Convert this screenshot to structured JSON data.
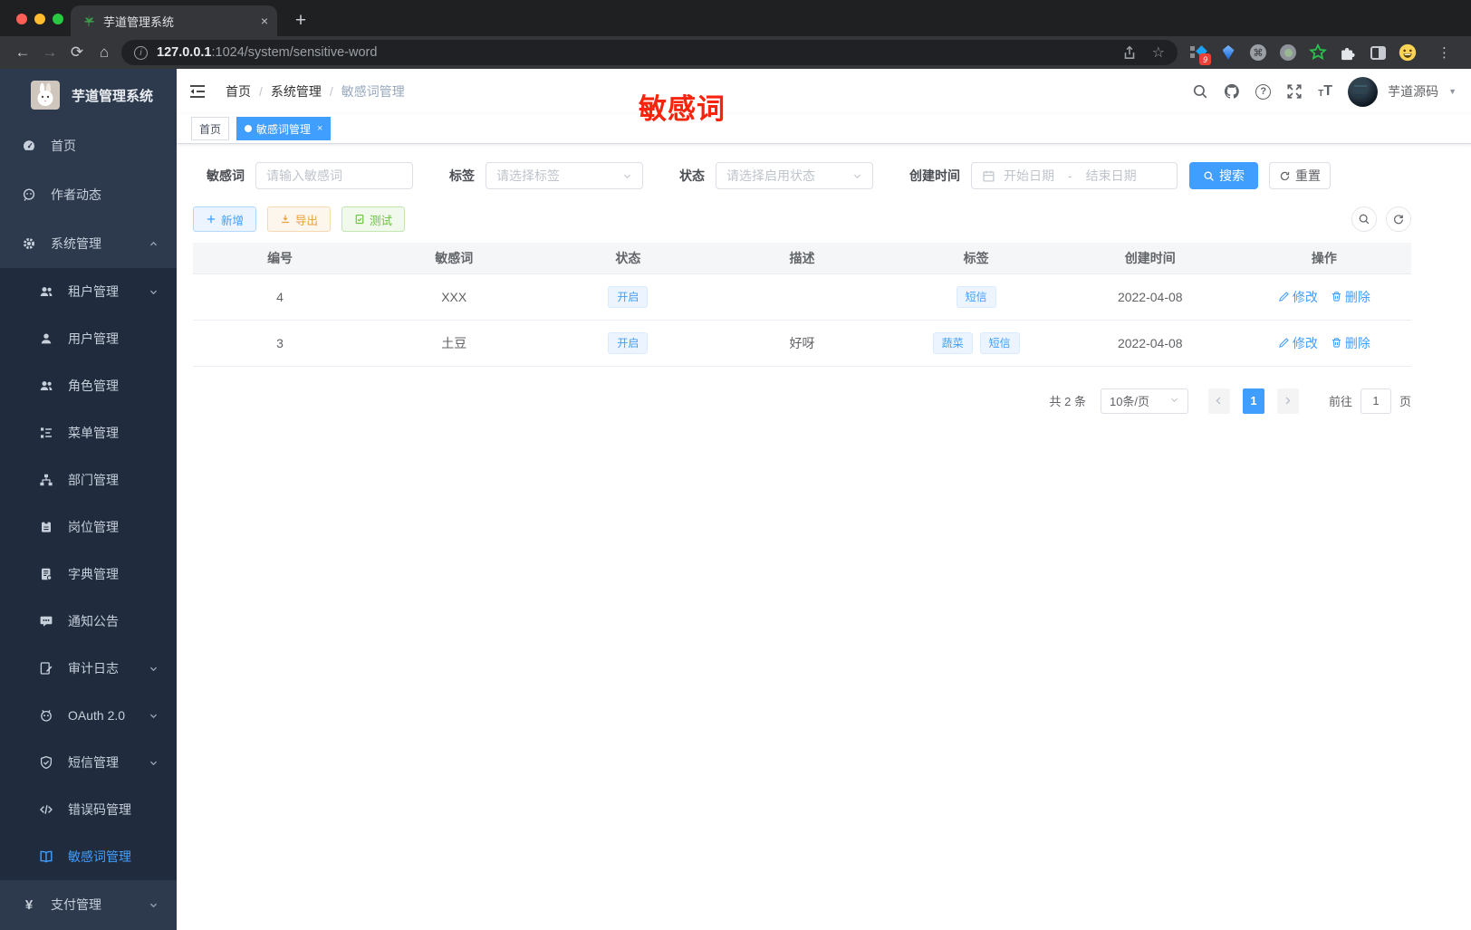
{
  "browser": {
    "tab_title": "芋道管理系统",
    "tab_close": "×",
    "new_tab_button": "+",
    "url_host": "127.0.0.1",
    "url_rest": ":1024/system/sensitive-word",
    "extension_badge": "9",
    "menu_dots": "⋮"
  },
  "sidebar": {
    "app_title": "芋道管理系统",
    "items": [
      {
        "label": "首页",
        "icon": "dashboard-icon",
        "level": 1
      },
      {
        "label": "作者动态",
        "icon": "author-feed-icon",
        "level": 1
      },
      {
        "label": "系统管理",
        "icon": "gear-icon",
        "level": 1,
        "arrow": "up"
      },
      {
        "label": "租户管理",
        "icon": "tenant-icon",
        "level": 2,
        "arrow": "down"
      },
      {
        "label": "用户管理",
        "icon": "user-icon",
        "level": 2
      },
      {
        "label": "角色管理",
        "icon": "role-icon",
        "level": 2
      },
      {
        "label": "菜单管理",
        "icon": "menu-tree-icon",
        "level": 2
      },
      {
        "label": "部门管理",
        "icon": "org-chart-icon",
        "level": 2
      },
      {
        "label": "岗位管理",
        "icon": "post-badge-icon",
        "level": 2
      },
      {
        "label": "字典管理",
        "icon": "dict-book-icon",
        "level": 2
      },
      {
        "label": "通知公告",
        "icon": "notice-bubble-icon",
        "level": 2
      },
      {
        "label": "审计日志",
        "icon": "audit-log-icon",
        "level": 2,
        "arrow": "down"
      },
      {
        "label": "OAuth 2.0",
        "icon": "oauth-robot-icon",
        "level": 2,
        "arrow": "down"
      },
      {
        "label": "短信管理",
        "icon": "sms-shield-icon",
        "level": 2,
        "arrow": "down"
      },
      {
        "label": "错误码管理",
        "icon": "error-code-icon",
        "level": 2
      },
      {
        "label": "敏感词管理",
        "icon": "sensitive-word-book-icon",
        "level": 2,
        "active": true
      },
      {
        "label": "支付管理",
        "icon": "payment-yen-icon",
        "level": 1,
        "arrow": "down"
      }
    ]
  },
  "header": {
    "breadcrumb": [
      "首页",
      "系统管理",
      "敏感词管理"
    ],
    "separator": "/",
    "annotation": "敏感词",
    "username": "芋道源码"
  },
  "tags_view": [
    {
      "label": "首页",
      "active": false
    },
    {
      "label": "敏感词管理",
      "active": true,
      "close": "×"
    }
  ],
  "filters": {
    "keyword_label": "敏感词",
    "keyword_placeholder": "请输入敏感词",
    "tag_label": "标签",
    "tag_placeholder": "请选择标签",
    "status_label": "状态",
    "status_placeholder": "请选择启用状态",
    "date_label": "创建时间",
    "date_start_placeholder": "开始日期",
    "date_separator": "-",
    "date_end_placeholder": "结束日期",
    "search_button": "搜索",
    "reset_button": "重置"
  },
  "toolbar": {
    "add_button": "新增",
    "export_button": "导出",
    "test_button": "测试"
  },
  "table": {
    "columns": [
      "编号",
      "敏感词",
      "状态",
      "描述",
      "标签",
      "创建时间",
      "操作"
    ],
    "edit_label": "修改",
    "delete_label": "删除",
    "rows": [
      {
        "id": "4",
        "word": "XXX",
        "status": "开启",
        "description": "",
        "tags": [
          "短信"
        ],
        "created_at": "2022-04-08"
      },
      {
        "id": "3",
        "word": "土豆",
        "status": "开启",
        "description": "好呀",
        "tags": [
          "蔬菜",
          "短信"
        ],
        "created_at": "2022-04-08"
      }
    ]
  },
  "pagination": {
    "total_label": "共 2 条",
    "page_size": "10条/页",
    "current_page": "1",
    "goto_label": "前往",
    "goto_value": "1",
    "page_unit": "页"
  },
  "colors": {
    "primary": "#409eff",
    "annotation_red": "#f7230c",
    "warning": "#e6a23c",
    "success": "#67c23a",
    "sidebar_bg": "#2d3a4d",
    "submenu_bg": "#202c3e"
  }
}
